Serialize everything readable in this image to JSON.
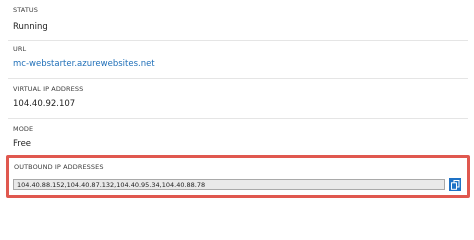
{
  "properties": {
    "status": {
      "label": "STATUS",
      "value": "Running"
    },
    "url": {
      "label": "URL",
      "value": "mc-webstarter.azurewebsites.net"
    },
    "virtual_ip": {
      "label": "VIRTUAL IP ADDRESS",
      "value": "104.40.92.107"
    },
    "mode": {
      "label": "MODE",
      "value": "Free"
    },
    "outbound_ips": {
      "label": "OUTBOUND IP ADDRESSES",
      "value": "104.40.88.152,104.40.87.132,104.40.95.34,104.40.88.78",
      "copy_icon": "copy-icon"
    }
  },
  "colors": {
    "link": "#1f6fb8",
    "highlight": "#e0584f",
    "copy_button": "#1e72c6"
  }
}
